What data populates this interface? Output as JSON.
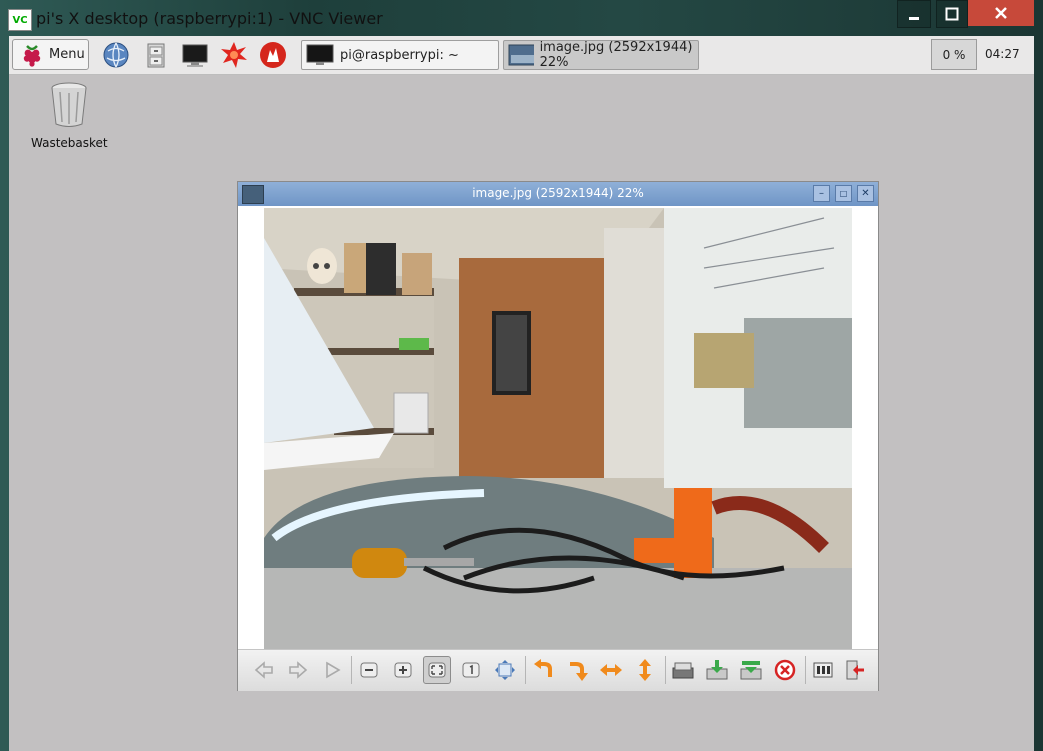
{
  "vnc_window": {
    "title": "pi's X desktop (raspberrypi:1) - VNC Viewer",
    "icon_label": "VC"
  },
  "taskbar": {
    "menu_label": "Menu",
    "launchers": [
      "globe-icon",
      "file-cabinet-icon",
      "terminal-monitor-icon",
      "red-burst-icon",
      "wolfram-icon"
    ],
    "tasks": [
      {
        "label": "pi@raspberrypi: ~",
        "icon": "terminal-icon"
      },
      {
        "label": "image.jpg (2592x1944) 22%",
        "icon": "image-thumbnail-icon"
      }
    ],
    "cpu_usage": "0 %",
    "clock": "04:27"
  },
  "desktop": {
    "icons": [
      {
        "label": "Wastebasket",
        "icon": "trash-icon"
      }
    ]
  },
  "viewer": {
    "title": "image.jpg (2592x1944) 22%",
    "toolbar": [
      "previous-icon",
      "next-icon",
      "slideshow-icon",
      "zoom-out-icon",
      "zoom-in-icon",
      "fit-window-icon",
      "original-size-icon",
      "fullscreen-icon",
      "rotate-left-icon",
      "rotate-right-icon",
      "flip-horizontal-icon",
      "flip-vertical-icon",
      "open-file-icon",
      "save-icon",
      "save-as-icon",
      "delete-icon",
      "preferences-icon",
      "exit-icon"
    ]
  },
  "colors": {
    "desktop_bg": "#c2c0c1",
    "viewer_title": "#7fa2cf",
    "close_red": "#c7493a",
    "tool_orange": "#f08a1c"
  }
}
